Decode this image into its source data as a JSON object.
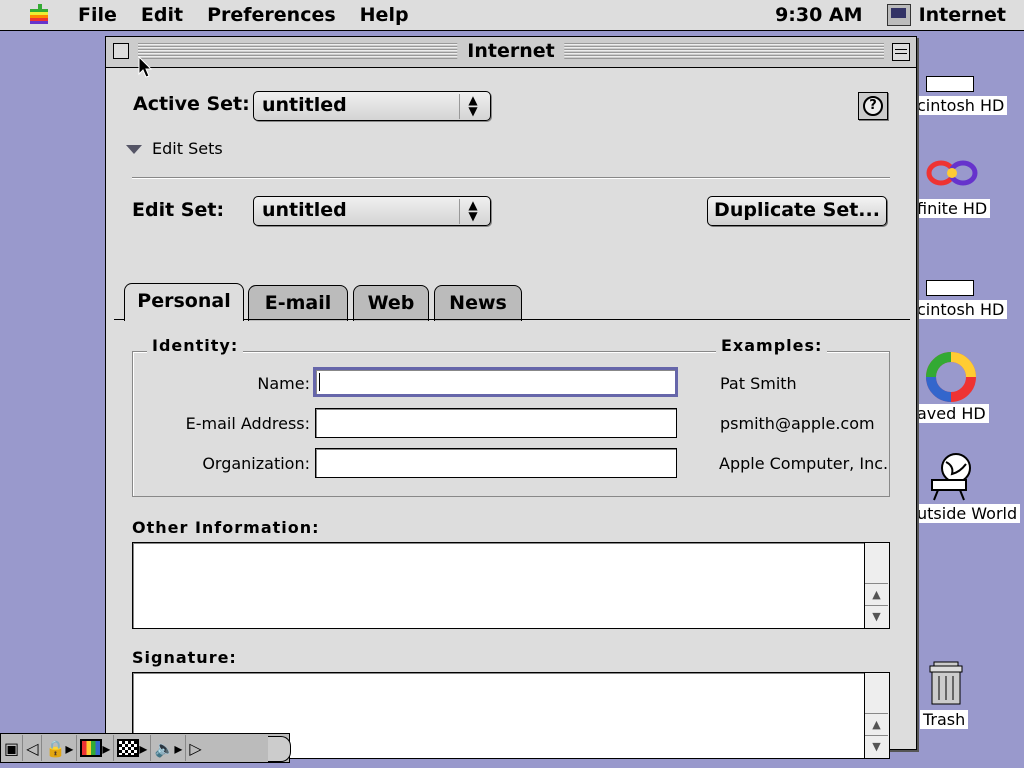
{
  "menubar": {
    "items": [
      "File",
      "Edit",
      "Preferences",
      "Help"
    ],
    "clock": "9:30 AM",
    "app_name": "Internet"
  },
  "window": {
    "title": "Internet",
    "active_set_label": "Active Set:",
    "active_set_value": "untitled",
    "edit_sets_label": "Edit Sets",
    "edit_set_label": "Edit Set:",
    "edit_set_value": "untitled",
    "duplicate_button": "Duplicate Set...",
    "tabs": [
      "Personal",
      "E-mail",
      "Web",
      "News"
    ],
    "active_tab": "Personal",
    "identity_title": "Identity:",
    "examples_title": "Examples:",
    "fields": [
      {
        "label": "Name:",
        "value": "",
        "example": "Pat Smith"
      },
      {
        "label": "E-mail Address:",
        "value": "",
        "example": "psmith@apple.com"
      },
      {
        "label": "Organization:",
        "value": "",
        "example": "Apple Computer, Inc."
      }
    ],
    "other_info_label": "Other Information:",
    "signature_label": "Signature:"
  },
  "desktop_icons": [
    {
      "label": "cintosh HD",
      "icon": "hard-disk-icon"
    },
    {
      "label": "finite HD",
      "icon": "infinite-disk-icon"
    },
    {
      "label": "cintosh HD",
      "icon": "hard-disk-icon"
    },
    {
      "label": "aved HD",
      "icon": "life-preserver-icon"
    },
    {
      "label": "utside World",
      "icon": "outside-world-icon"
    },
    {
      "label": "Trash",
      "icon": "trash-icon"
    }
  ],
  "colors": {
    "desktop": "#9999cc",
    "window_bg": "#dddddd",
    "focus_ring": "#6666aa"
  }
}
